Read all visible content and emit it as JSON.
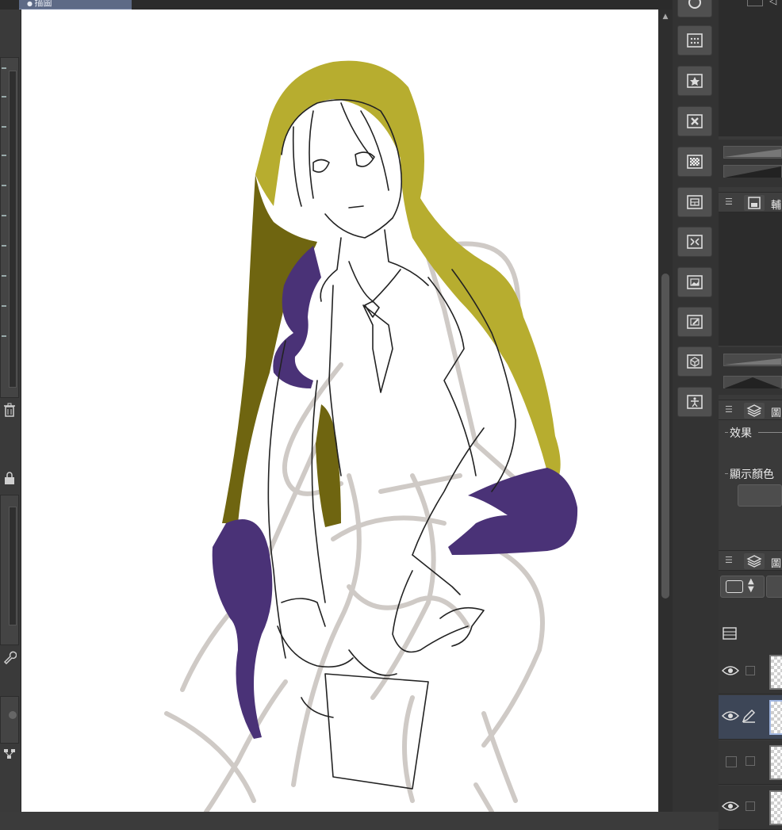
{
  "document_tab": {
    "title": "描圖"
  },
  "left_panel": {
    "trash_icon": "trash-icon",
    "lock_icon": "lock-icon",
    "wrench_icon": "wrench-icon"
  },
  "canvas": {
    "background": "#ffffff",
    "hair_color": "#b7ad2f",
    "hair_shadow_color": "#6f6510",
    "tentacle_color": "#4a3277",
    "sketch_color": "#cfcac6",
    "lineart_color": "#222222"
  },
  "right_tool_buttons": [
    {
      "name": "material-grid-icon"
    },
    {
      "name": "material-favorite-icon"
    },
    {
      "name": "material-delete-icon"
    },
    {
      "name": "material-pattern-icon"
    },
    {
      "name": "material-layout-icon"
    },
    {
      "name": "material-arrows-icon"
    },
    {
      "name": "material-image-icon"
    },
    {
      "name": "material-edit-icon"
    },
    {
      "name": "material-3d-icon"
    },
    {
      "name": "material-pose-icon"
    }
  ],
  "panels": {
    "sub_view_tab": {
      "label": "輔"
    },
    "layer_property_tab": {
      "label": "圖"
    },
    "layer_panel_tab": {
      "label": "圖"
    },
    "effect_label": "效果",
    "display_color_label": "顯示顏色"
  },
  "layers": [
    {
      "visible": true,
      "selected": false,
      "editing": false
    },
    {
      "visible": true,
      "selected": true,
      "editing": true
    },
    {
      "visible": false,
      "selected": false,
      "editing": false
    },
    {
      "visible": true,
      "selected": false,
      "editing": false
    }
  ]
}
